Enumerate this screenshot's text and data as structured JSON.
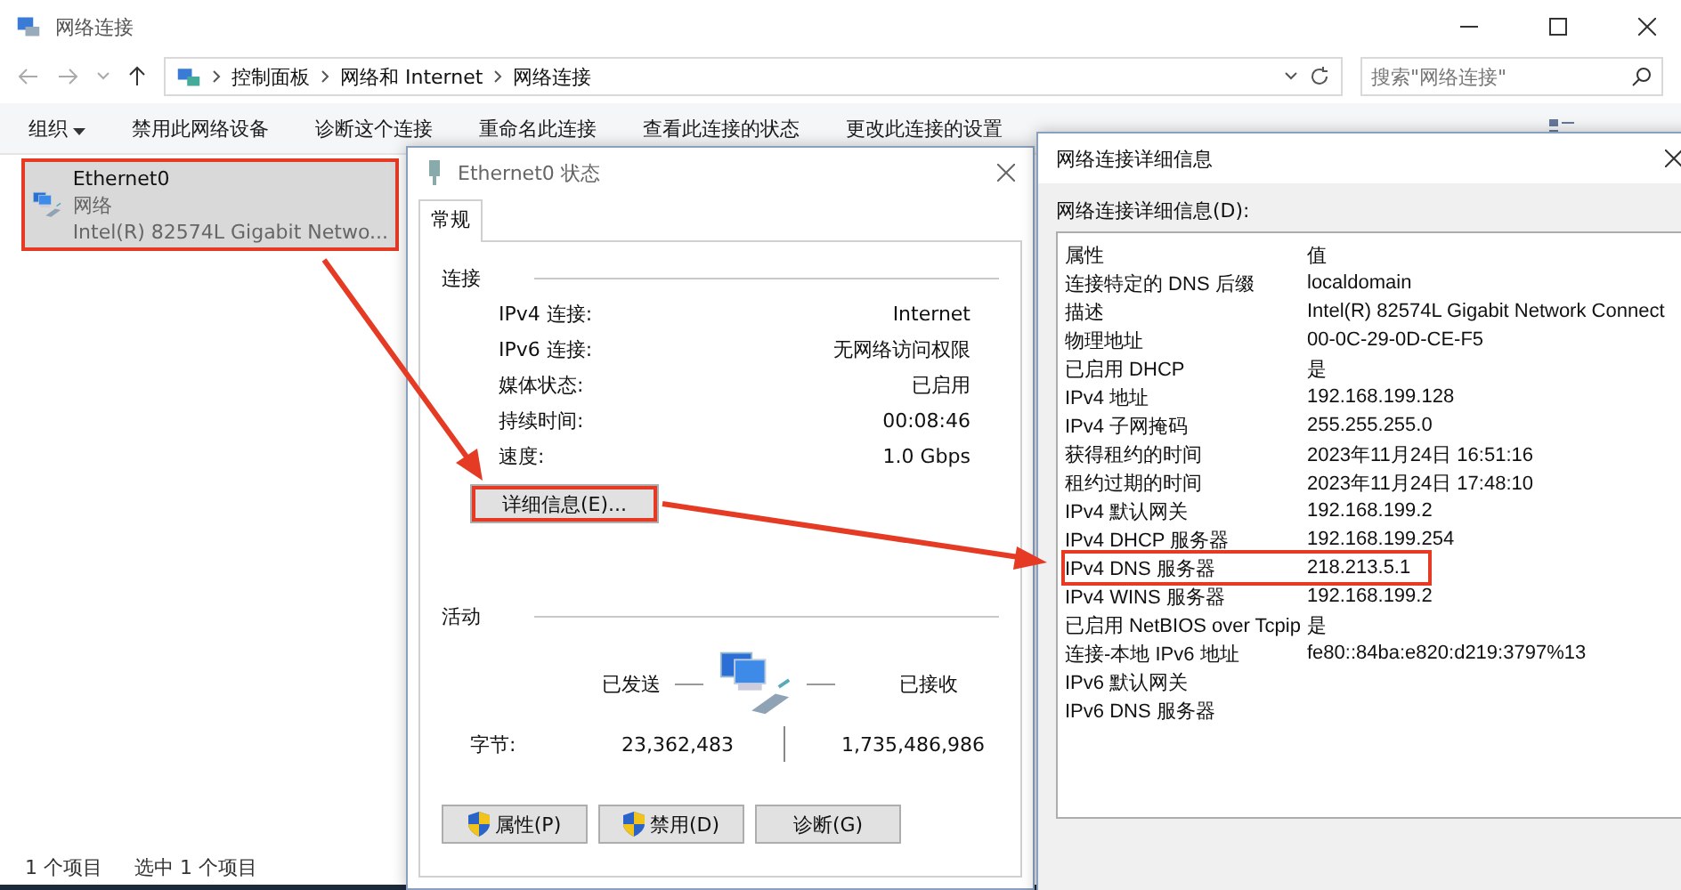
{
  "window": {
    "title": "网络连接"
  },
  "address": {
    "crumbs": [
      "控制面板",
      "网络和 Internet",
      "网络连接"
    ],
    "search_placeholder": "搜索\"网络连接\""
  },
  "toolbar": [
    {
      "label": "组织",
      "kind": "menu"
    },
    {
      "label": "禁用此网络设备",
      "kind": "plain"
    },
    {
      "label": "诊断这个连接",
      "kind": "plain"
    },
    {
      "label": "重命名此连接",
      "kind": "plain"
    },
    {
      "label": "查看此连接的状态",
      "kind": "plain"
    },
    {
      "label": "更改此连接的设置",
      "kind": "plain"
    }
  ],
  "connections": [
    {
      "name": "Ethernet0",
      "type": "网络",
      "adapter": "Intel(R) 82574L Gigabit Netwo...",
      "selected": true,
      "highlighted": true
    }
  ],
  "status_bar": [
    "1 个项目",
    "选中 1 个项目"
  ],
  "status_dialog": {
    "title": "Ethernet0 状态",
    "tabs": [
      {
        "label": "常规",
        "selected": true
      }
    ],
    "connection_heading": "连接",
    "rows": [
      {
        "label": "IPv4 连接:",
        "value": "Internet"
      },
      {
        "label": "IPv6 连接:",
        "value": "无网络访问权限"
      },
      {
        "label": "媒体状态:",
        "value": "已启用"
      },
      {
        "label": "持续时间:",
        "value": "00:08:46"
      },
      {
        "label": "速度:",
        "value": "1.0 Gbps"
      }
    ],
    "details_button": {
      "label": "详细信息(E)...",
      "highlighted": true
    },
    "activity_heading": "活动",
    "sent_label": "已发送",
    "received_label": "已接收",
    "bytes_label": "字节:",
    "bytes_sent": "23,362,483",
    "bytes_received": "1,735,486,986",
    "buttons": [
      {
        "label": "属性(P)",
        "kind": "shield"
      },
      {
        "label": "禁用(D)",
        "kind": "shield"
      },
      {
        "label": "诊断(G)",
        "kind": "plain"
      }
    ]
  },
  "details_dialog": {
    "title": "网络连接详细信息",
    "list_label": "网络连接详细信息(D):",
    "columns": [
      "属性",
      "值"
    ],
    "rows": [
      {
        "property": "连接特定的 DNS 后缀",
        "value": "localdomain",
        "highlighted": false
      },
      {
        "property": "描述",
        "value": "Intel(R) 82574L Gigabit Network Connect",
        "highlighted": false
      },
      {
        "property": "物理地址",
        "value": "00-0C-29-0D-CE-F5",
        "highlighted": false
      },
      {
        "property": "已启用 DHCP",
        "value": "是",
        "highlighted": false
      },
      {
        "property": "IPv4 地址",
        "value": "192.168.199.128",
        "highlighted": false
      },
      {
        "property": "IPv4 子网掩码",
        "value": "255.255.255.0",
        "highlighted": false
      },
      {
        "property": "获得租约的时间",
        "value": "2023年11月24日 16:51:16",
        "highlighted": false
      },
      {
        "property": "租约过期的时间",
        "value": "2023年11月24日 17:48:10",
        "highlighted": false
      },
      {
        "property": "IPv4 默认网关",
        "value": "192.168.199.2",
        "highlighted": false
      },
      {
        "property": "IPv4 DHCP 服务器",
        "value": "192.168.199.254",
        "highlighted": false
      },
      {
        "property": "IPv4 DNS 服务器",
        "value": "218.213.5.1",
        "highlighted": true
      },
      {
        "property": "IPv4 WINS 服务器",
        "value": "192.168.199.2",
        "highlighted": false
      },
      {
        "property": "已启用 NetBIOS over Tcpip",
        "value": "是",
        "highlighted": false
      },
      {
        "property": "连接-本地 IPv6 地址",
        "value": "fe80::84ba:e820:d219:3797%13",
        "highlighted": false
      },
      {
        "property": "IPv6 默认网关",
        "value": "",
        "highlighted": false
      },
      {
        "property": "IPv6 DNS 服务器",
        "value": "",
        "highlighted": false
      }
    ]
  }
}
